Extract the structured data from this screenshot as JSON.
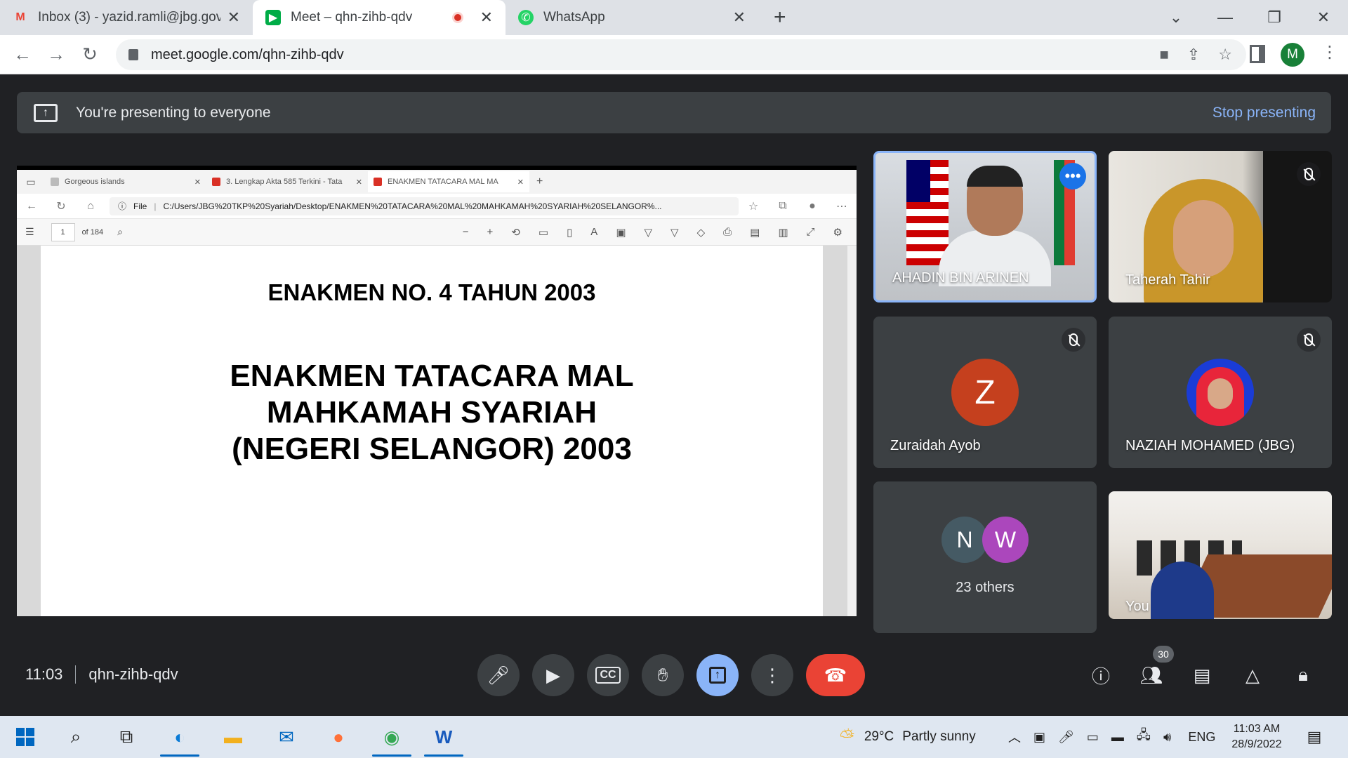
{
  "browser": {
    "tabs": [
      {
        "title": "Inbox (3) - yazid.ramli@jbg.gov.my",
        "icon": "gmail-icon"
      },
      {
        "title": "Meet – qhn-zihb-qdv",
        "icon": "meet-icon",
        "active": true
      },
      {
        "title": "WhatsApp",
        "icon": "whatsapp-icon"
      }
    ],
    "url": "meet.google.com/qhn-zihb-qdv",
    "profile_initial": "M"
  },
  "banner": {
    "text": "You're presenting to everyone",
    "stop_label": "Stop presenting"
  },
  "shared_screen": {
    "tabs": [
      "Gorgeous islands",
      "3. Lengkap Akta 585 Terkini - Tata",
      "ENAKMEN TATACARA MAL MA"
    ],
    "file_label": "File",
    "url": "C:/Users/JBG%20TKP%20Syariah/Desktop/ENAKMEN%20TATACARA%20MAL%20MAHKAMAH%20SYARIAH%20SELANGOR%...",
    "page": "1",
    "page_total": "of 184",
    "doc_title": "ENAKMEN NO. 4 TAHUN 2003",
    "doc_heading_lines": [
      "ENAKMEN TATACARA MAL",
      "MAHKAMAH SYARIAH",
      "(NEGERI SELANGOR) 2003"
    ]
  },
  "participants": {
    "ahadin": "AHADIN BIN ARINEN",
    "taherah": "Taherah Tahir",
    "zuraidah": {
      "name": "Zuraidah Ayob",
      "initial": "Z",
      "color": "#c5401e"
    },
    "naziah": "NAZIAH MOHAMED (JBG)",
    "others": {
      "initials": [
        "N",
        "W"
      ],
      "colors": [
        "#455a64",
        "#ab47bc"
      ],
      "label": "23 others"
    },
    "you": "You"
  },
  "meeting": {
    "time": "11:03",
    "code": "qhn-zihb-qdv",
    "participant_count": "30"
  },
  "taskbar": {
    "weather_temp": "29°C",
    "weather_text": "Partly sunny",
    "lang": "ENG",
    "time": "11:03 AM",
    "date": "28/9/2022"
  }
}
